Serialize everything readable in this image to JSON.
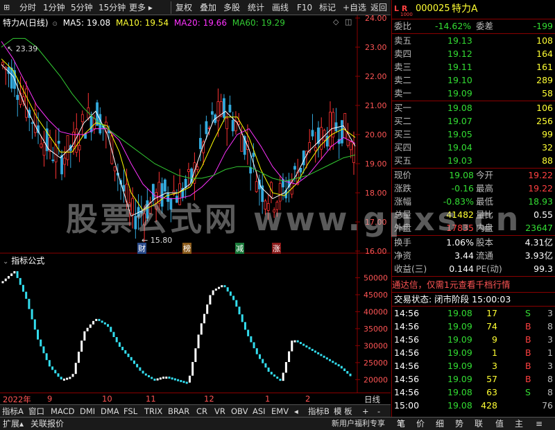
{
  "toolbar": {
    "items": [
      "分时",
      "1分钟",
      "5分钟",
      "15分钟",
      "更多 ▸",
      "复权",
      "叠加",
      "多股",
      "统计",
      "画线",
      "F10",
      "标记",
      "+自选",
      "返回"
    ]
  },
  "main_chart": {
    "title": "特力A(日线)",
    "ma5": "MA5: 19.08",
    "ma10": "MA10: 19.54",
    "ma20": "MA20: 19.66",
    "ma60": "MA60: 19.29",
    "y_ticks": [
      "24.00",
      "23.00",
      "22.00",
      "21.00",
      "20.00",
      "19.00",
      "18.00",
      "17.00",
      "16.00"
    ],
    "high_marker": "23.39",
    "low_marker": "15.80",
    "event_labels": [
      "财",
      "榜",
      "减",
      "涨"
    ],
    "colors": {
      "ma5": "#ffffff",
      "ma10": "#ffff00",
      "ma20": "#ff33ff",
      "ma60": "#33cc33",
      "up": "#ff3333",
      "down": "#33aadd"
    }
  },
  "sub_chart": {
    "title": "指标公式",
    "y_ticks": [
      "50000",
      "45000",
      "40000",
      "35000",
      "30000",
      "25000",
      "20000"
    ]
  },
  "chart_data": [
    {
      "type": "line",
      "title": "特力A(日线)",
      "series": [
        {
          "name": "MA5",
          "values": [
            22.4,
            22.0,
            21.0,
            20.2,
            19.5,
            19.2,
            19.6,
            20.4,
            20.8,
            20.0,
            18.5,
            17.2,
            17.4,
            17.8,
            18.0,
            18.0,
            18.3,
            19.5,
            20.5,
            20.8,
            20.4,
            19.5,
            18.2,
            17.8,
            18.0,
            18.6,
            19.4,
            19.8,
            20.2,
            20.3,
            19.6
          ]
        },
        {
          "name": "MA10",
          "values": [
            22.6,
            22.2,
            21.4,
            20.6,
            20.0,
            19.4,
            19.4,
            20.0,
            20.4,
            20.3,
            19.4,
            18.0,
            17.4,
            17.6,
            17.9,
            18.0,
            18.2,
            18.9,
            19.8,
            20.6,
            20.6,
            19.9,
            18.8,
            18.0,
            17.9,
            18.3,
            19.0,
            19.6,
            20.0,
            20.2,
            19.9
          ]
        },
        {
          "name": "MA20",
          "values": [
            23.2,
            22.6,
            21.8,
            21.0,
            20.5,
            20.1,
            20.0,
            20.0,
            20.2,
            20.2,
            19.8,
            19.0,
            18.3,
            17.9,
            17.8,
            17.8,
            17.9,
            18.2,
            18.6,
            19.4,
            20.0,
            20.2,
            19.6,
            18.9,
            18.4,
            18.3,
            18.6,
            19.1,
            19.6,
            19.9,
            19.7
          ]
        },
        {
          "name": "MA60",
          "values": [
            23.0,
            23.3,
            23.3,
            23.0,
            22.5,
            22.0,
            21.4,
            20.9,
            20.5,
            20.2,
            19.9,
            19.6,
            19.3,
            19.0,
            18.8,
            18.6,
            18.5,
            18.5,
            18.6,
            18.8,
            18.9,
            18.9,
            18.7,
            18.5,
            18.4,
            18.5,
            18.6,
            18.8,
            19.0,
            19.2,
            19.3
          ]
        }
      ],
      "ylim": [
        16,
        24
      ]
    },
    {
      "type": "line",
      "title": "指标公式",
      "series": [
        {
          "name": "",
          "values": [
            49000,
            52000,
            44000,
            32000,
            24000,
            20000,
            21000,
            34000,
            38000,
            36000,
            30000,
            26000,
            22000,
            20000,
            21000,
            20000,
            19000,
            35000,
            46000,
            48000,
            43000,
            34000,
            27000,
            22000,
            19500,
            32000,
            30000,
            28000,
            26000,
            24000,
            21000
          ]
        }
      ],
      "ylim": [
        17000,
        55000
      ]
    }
  ],
  "bottom_bar": {
    "months": [
      "2022年",
      "9",
      "10",
      "11",
      "12",
      "1",
      "2"
    ],
    "period": "日线",
    "tabs": [
      "指标A",
      "窗口",
      "MACD",
      "DMI",
      "DMA",
      "FSL",
      "TRIX",
      "BRAR",
      "CR",
      "VR",
      "OBV",
      "ASI",
      "EMV",
      "◂",
      "指标B",
      "模 板",
      "+",
      "-"
    ]
  },
  "status_bar": {
    "items": [
      "扩展▴",
      "关联报价",
      "新用户福利专享",
      "笔",
      "价",
      "细",
      "势",
      "联",
      "值",
      "主",
      "≡"
    ]
  },
  "quote": {
    "code_prefix": "L R",
    "code_sub": "1000",
    "code": "000025",
    "name": "特力A",
    "weibi_label": "委比",
    "weibi": "-14.62%",
    "weicha_label": "委差",
    "weicha": "-199",
    "asks": [
      {
        "label": "卖五",
        "price": "19.13",
        "vol": "108"
      },
      {
        "label": "卖四",
        "price": "19.12",
        "vol": "164"
      },
      {
        "label": "卖三",
        "price": "19.11",
        "vol": "161"
      },
      {
        "label": "卖二",
        "price": "19.10",
        "vol": "289"
      },
      {
        "label": "卖一",
        "price": "19.09",
        "vol": "58"
      }
    ],
    "bids": [
      {
        "label": "买一",
        "price": "19.08",
        "vol": "106"
      },
      {
        "label": "买二",
        "price": "19.07",
        "vol": "256"
      },
      {
        "label": "买三",
        "price": "19.05",
        "vol": "99"
      },
      {
        "label": "买四",
        "price": "19.04",
        "vol": "32"
      },
      {
        "label": "买五",
        "price": "19.03",
        "vol": "88"
      }
    ],
    "stats": [
      {
        "l1": "现价",
        "v1": "19.08",
        "l2": "今开",
        "v2": "19.22"
      },
      {
        "l1": "涨跌",
        "v1": "-0.16",
        "l2": "最高",
        "v2": "19.22"
      },
      {
        "l1": "涨幅",
        "v1": "-0.83%",
        "l2": "最低",
        "v2": "18.93"
      },
      {
        "l1": "总量",
        "v1": "41482",
        "l2": "量比",
        "v2": "0.55"
      },
      {
        "l1": "外盘",
        "v1": "17835",
        "l2": "内盘",
        "v2": "23647"
      }
    ],
    "fund": [
      {
        "l1": "换手",
        "v1": "1.06%",
        "l2": "股本",
        "v2": "4.31亿"
      },
      {
        "l1": "净资",
        "v1": "3.44",
        "l2": "流通",
        "v2": "3.93亿"
      },
      {
        "l1": "收益(三)",
        "v1": "0.144",
        "l2": "PE(动)",
        "v2": "99.3"
      }
    ],
    "promo": "通达信，仅需1元查看千档行情",
    "trade_status": "交易状态: 闭市阶段  15:00:03",
    "ticks": [
      {
        "t": "14:56",
        "p": "19.08",
        "v": "17",
        "d": "S",
        "n": "3"
      },
      {
        "t": "14:56",
        "p": "19.09",
        "v": "74",
        "d": "B",
        "n": "8"
      },
      {
        "t": "14:56",
        "p": "19.09",
        "v": "9",
        "d": "B",
        "n": "3"
      },
      {
        "t": "14:56",
        "p": "19.09",
        "v": "1",
        "d": "B",
        "n": "1"
      },
      {
        "t": "14:56",
        "p": "19.09",
        "v": "3",
        "d": "B",
        "n": "3"
      },
      {
        "t": "14:56",
        "p": "19.09",
        "v": "57",
        "d": "B",
        "n": "8"
      },
      {
        "t": "14:56",
        "p": "19.08",
        "v": "63",
        "d": "S",
        "n": "8"
      },
      {
        "t": "15:00",
        "p": "19.08",
        "v": "428",
        "d": "",
        "n": "76"
      }
    ]
  },
  "watermark": "股票公式网 www.gpxs.cn"
}
